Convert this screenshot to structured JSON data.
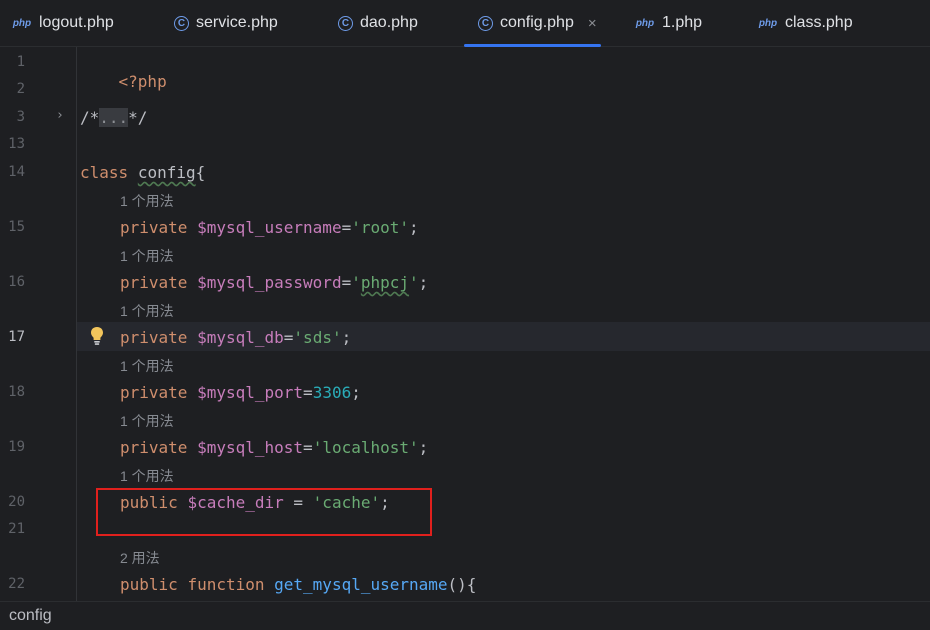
{
  "tabs": [
    {
      "label": "logout.php",
      "icon": "php-file-icon",
      "icon_text": "php"
    },
    {
      "label": "service.php",
      "icon": "class-file-icon",
      "icon_text": "C"
    },
    {
      "label": "dao.php",
      "icon": "class-file-icon",
      "icon_text": "C"
    },
    {
      "label": "config.php",
      "icon": "class-file-icon",
      "icon_text": "C",
      "active": true,
      "close": "×"
    },
    {
      "label": "1.php",
      "icon": "php-file-icon",
      "icon_text": "php"
    },
    {
      "label": "class.php",
      "icon": "php-file-icon",
      "icon_text": "php"
    }
  ],
  "gutter": {
    "line_numbers": [
      "1",
      "2",
      "3",
      "13",
      "14",
      "15",
      "16",
      "17",
      "18",
      "19",
      "20",
      "21",
      "22"
    ],
    "current_line": "17",
    "fold_marker": "›"
  },
  "code": {
    "l1": {
      "text": "<?php"
    },
    "l3": {
      "open": "/*",
      "dots": "...",
      "close": "*/"
    },
    "l14": {
      "kw": "class",
      "name": "config",
      "brace": "{"
    },
    "hint1": "1 个用法",
    "l15": {
      "kw": "private",
      "var": "$mysql_username",
      "eq": "=",
      "str": "'root'",
      "semi": ";"
    },
    "hint2": "1 个用法",
    "l16": {
      "kw": "private",
      "var": "$mysql_password",
      "eq": "=",
      "q1": "'",
      "strmid": "phpcj",
      "q2": "'",
      "semi": ";"
    },
    "hint3": "1 个用法",
    "l17": {
      "kw": "private",
      "var": "$mysql_db",
      "eq": "=",
      "str": "'sds'",
      "semi": ";"
    },
    "hint4": "1 个用法",
    "l18": {
      "kw": "private",
      "var": "$mysql_port",
      "eq": "=",
      "num": "3306",
      "semi": ";"
    },
    "hint5": "1 个用法",
    "l19": {
      "kw": "private",
      "var": "$mysql_host",
      "eq": "=",
      "str": "'localhost'",
      "semi": ";"
    },
    "hint6": "1 个用法",
    "l20": {
      "kw": "public",
      "var": "$cache_dir",
      "eq": " = ",
      "str": "'cache'",
      "semi": ";"
    },
    "hint7": "2 用法",
    "l22": {
      "kw1": "public",
      "kw2": "function",
      "fn": "get_mysql_username",
      "paren": "(){"
    }
  },
  "statusbar": {
    "breadcrumb": "config"
  },
  "colors": {
    "keyword": "#cf8e6d",
    "variable": "#c77dbb",
    "string": "#6aab73",
    "number": "#2aacb8",
    "function": "#56a8f5",
    "highlight_box": "#e0201d",
    "active_tab_underline": "#3574f0"
  }
}
